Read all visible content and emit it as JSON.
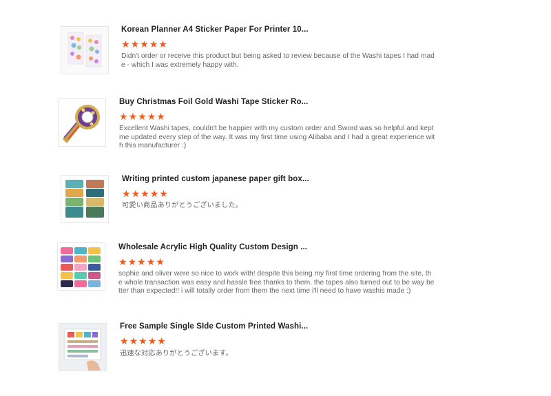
{
  "reviews": [
    {
      "product_title": "Korean Planner A4 Sticker Paper For Printer 10...",
      "rating": 5,
      "comment": "Didn't order or receive this product but being asked to review because of the Washi tapes I had made - which I was extremely happy with.",
      "thumb_icon": "sticker-sheet-image"
    },
    {
      "product_title": "Buy Christmas Foil Gold Washi Tape Sticker Ro...",
      "rating": 5,
      "comment": "Excellent Washi tapes, couldn't be happier with my custom order and Sword was so helpful and kept me updated every step of the way. It was my first time using Alibaba and I had a great experience with this manufacturer :)",
      "thumb_icon": "washi-roll-image"
    },
    {
      "product_title": "Writing printed custom japanese paper gift box...",
      "rating": 5,
      "comment": "可愛い商品ありがとうございました。",
      "thumb_icon": "washi-stack-image"
    },
    {
      "product_title": "Wholesale Acrylic High Quality Custom Design ...",
      "rating": 5,
      "comment": "sophie and oliver were so nice to work with! despite this being my first time ordering from the site, the whole transaction was easy and hassle free thanks to them. the tapes also turned out to be way better than expected!! i will totally order from them the next time i'll need to have washis made :)",
      "thumb_icon": "washi-grid-image"
    },
    {
      "product_title": "Free Sample Single SIde Custom Printed Washi...",
      "rating": 5,
      "comment": "迅速な対応ありがとうございます。",
      "thumb_icon": "sample-card-image"
    }
  ]
}
